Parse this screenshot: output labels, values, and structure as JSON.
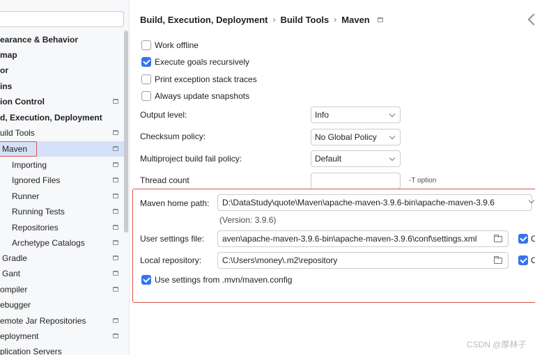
{
  "sidebar": {
    "items": [
      {
        "label": "earance & Behavior",
        "bold": true
      },
      {
        "label": "map",
        "bold": true
      },
      {
        "label": "or",
        "bold": true
      },
      {
        "label": "ins",
        "bold": true
      },
      {
        "label": "ion Control",
        "bold": true
      },
      {
        "label": "d, Execution, Deployment",
        "bold": true
      },
      {
        "label": "uild Tools"
      },
      {
        "label": "Maven",
        "selected": true
      },
      {
        "label": "Importing"
      },
      {
        "label": "Ignored Files"
      },
      {
        "label": "Runner"
      },
      {
        "label": "Running Tests"
      },
      {
        "label": "Repositories"
      },
      {
        "label": "Archetype Catalogs"
      },
      {
        "label": "Gradle"
      },
      {
        "label": "Gant"
      },
      {
        "label": "ompiler"
      },
      {
        "label": "ebugger"
      },
      {
        "label": "emote Jar Repositories"
      },
      {
        "label": "eployment"
      },
      {
        "label": "plication Servers"
      }
    ]
  },
  "breadcrumb": {
    "part1": "Build, Execution, Deployment",
    "sep": "›",
    "part2": "Build Tools",
    "part3": "Maven"
  },
  "options": {
    "work_offline": "Work offline",
    "execute_goals": "Execute goals recursively",
    "print_stack": "Print exception stack traces",
    "update_snapshots": "Always update snapshots"
  },
  "fields": {
    "output_level_label": "Output level:",
    "output_level_value": "Info",
    "checksum_label": "Checksum policy:",
    "checksum_value": "No Global Policy",
    "multiproject_label": "Multiproject build fail policy:",
    "multiproject_value": "Default",
    "thread_count_label": "Thread count",
    "thread_hint": "-T option"
  },
  "maven": {
    "home_label": "Maven home path:",
    "home_value": "D:\\DataStudy\\quote\\Maven\\apache-maven-3.9.6-bin\\apache-maven-3.9.6",
    "version": "(Version: 3.9.6)",
    "settings_label": "User settings file:",
    "settings_value": "aven\\apache-maven-3.9.6-bin\\apache-maven-3.9.6\\conf\\settings.xml",
    "repo_label": "Local repository:",
    "repo_value": "C:\\Users\\money\\.m2\\repository",
    "use_settings": "Use settings from .mvn/maven.config",
    "override_letter": "O"
  },
  "watermark": "CSDN @厚林子"
}
